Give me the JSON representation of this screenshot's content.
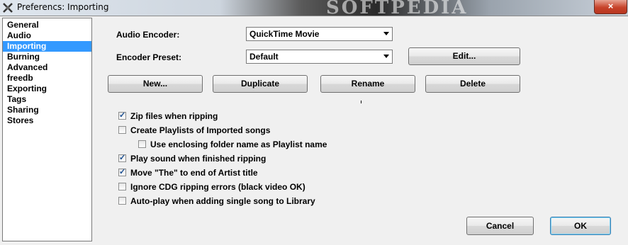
{
  "window": {
    "title": "Preferencs: Importing",
    "watermark": "SOFTPEDIA",
    "close_label": "×"
  },
  "sidebar": {
    "items": [
      {
        "label": "General",
        "selected": false
      },
      {
        "label": "Audio",
        "selected": false
      },
      {
        "label": "Importing",
        "selected": true
      },
      {
        "label": "Burning",
        "selected": false
      },
      {
        "label": "Advanced",
        "selected": false
      },
      {
        "label": "freedb",
        "selected": false
      },
      {
        "label": "Exporting",
        "selected": false
      },
      {
        "label": "Tags",
        "selected": false
      },
      {
        "label": "Sharing",
        "selected": false
      },
      {
        "label": "Stores",
        "selected": false
      }
    ]
  },
  "form": {
    "audio_encoder_label": "Audio Encoder:",
    "audio_encoder_value": "QuickTime Movie",
    "encoder_preset_label": "Encoder Preset:",
    "encoder_preset_value": "Default",
    "edit_label": "Edit..."
  },
  "preset_buttons": {
    "new": "New...",
    "duplicate": "Duplicate",
    "rename": "Rename",
    "delete": "Delete"
  },
  "options": [
    {
      "label": "Zip files when ripping",
      "checked": true
    },
    {
      "label": "Create Playlists of Imported songs",
      "checked": false
    },
    {
      "label": "Use enclosing folder name as Playlist name",
      "checked": false
    },
    {
      "label": "Play sound when finished ripping",
      "checked": true
    },
    {
      "label": "Move \"The\" to end of Artist title",
      "checked": true
    },
    {
      "label": "Ignore CDG ripping errors (black video OK)",
      "checked": false
    },
    {
      "label": "Auto-play when adding single song to Library",
      "checked": false
    }
  ],
  "footer": {
    "cancel_label": "Cancel",
    "ok_label": "OK"
  },
  "colors": {
    "selection": "#3399ff",
    "close_button": "#c7432a"
  }
}
